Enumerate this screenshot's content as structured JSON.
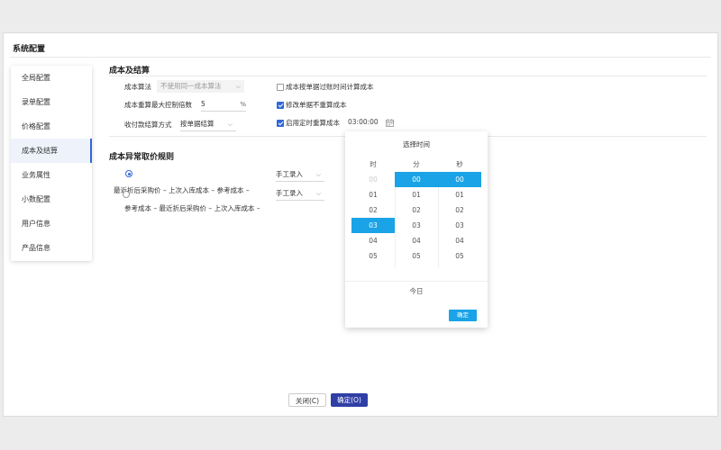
{
  "dialog": {
    "title": "系统配置"
  },
  "sidebar": {
    "items": [
      {
        "label": "全局配置"
      },
      {
        "label": "录单配置"
      },
      {
        "label": "价格配置"
      },
      {
        "label": "成本及结算"
      },
      {
        "label": "业务属性"
      },
      {
        "label": "小数配置"
      },
      {
        "label": "用户信息"
      },
      {
        "label": "产品信息"
      }
    ],
    "active_index": 3
  },
  "cost_section": {
    "title": "成本及结算",
    "algorithm": {
      "label": "成本算法",
      "value": "不使用同一成本算法"
    },
    "max_recalc": {
      "label": "成本重算最大控制倍数",
      "value": "5",
      "unit": "%"
    },
    "settlement": {
      "label": "收付款结算方式",
      "value": "按单据结算"
    },
    "chk_by_date": {
      "label": "成本按单据过账时间计算成本",
      "checked": false
    },
    "chk_no_recalc": {
      "label": "修改单据不重算成本",
      "checked": true
    },
    "chk_timed": {
      "label": "启用定时重算成本",
      "checked": true,
      "time": "03:00:00"
    }
  },
  "abnormal_section": {
    "title": "成本异常取价规则",
    "rule1": {
      "text": "最近折后采购价 – 上次入库成本 – 参考成本 –",
      "mode": "手工录入",
      "selected": true
    },
    "rule2": {
      "text": "参考成本 – 最近折后采购价 – 上次入库成本 –",
      "mode": "手工录入",
      "selected": false
    }
  },
  "time_picker": {
    "title": "选择时间",
    "headers": [
      "时",
      "分",
      "秒"
    ],
    "hours": [
      "00",
      "01",
      "02",
      "03",
      "04",
      "05"
    ],
    "minutes": [
      "00",
      "01",
      "02",
      "03",
      "04",
      "05"
    ],
    "seconds": [
      "00",
      "01",
      "02",
      "03",
      "04",
      "05"
    ],
    "selected": {
      "hour": "03",
      "minute": "00",
      "second": "00"
    },
    "today_label": "今日",
    "ok_label": "确定"
  },
  "footer": {
    "close_label": "关闭(C)",
    "ok_label": "确定(O)"
  },
  "colors": {
    "accent": "#2f68d7",
    "picker_accent": "#1aa3e6",
    "ok_button": "#2f3fa6"
  },
  "icons": {
    "calendar": "calendar-icon",
    "dropdown": "chevron-down-icon"
  }
}
